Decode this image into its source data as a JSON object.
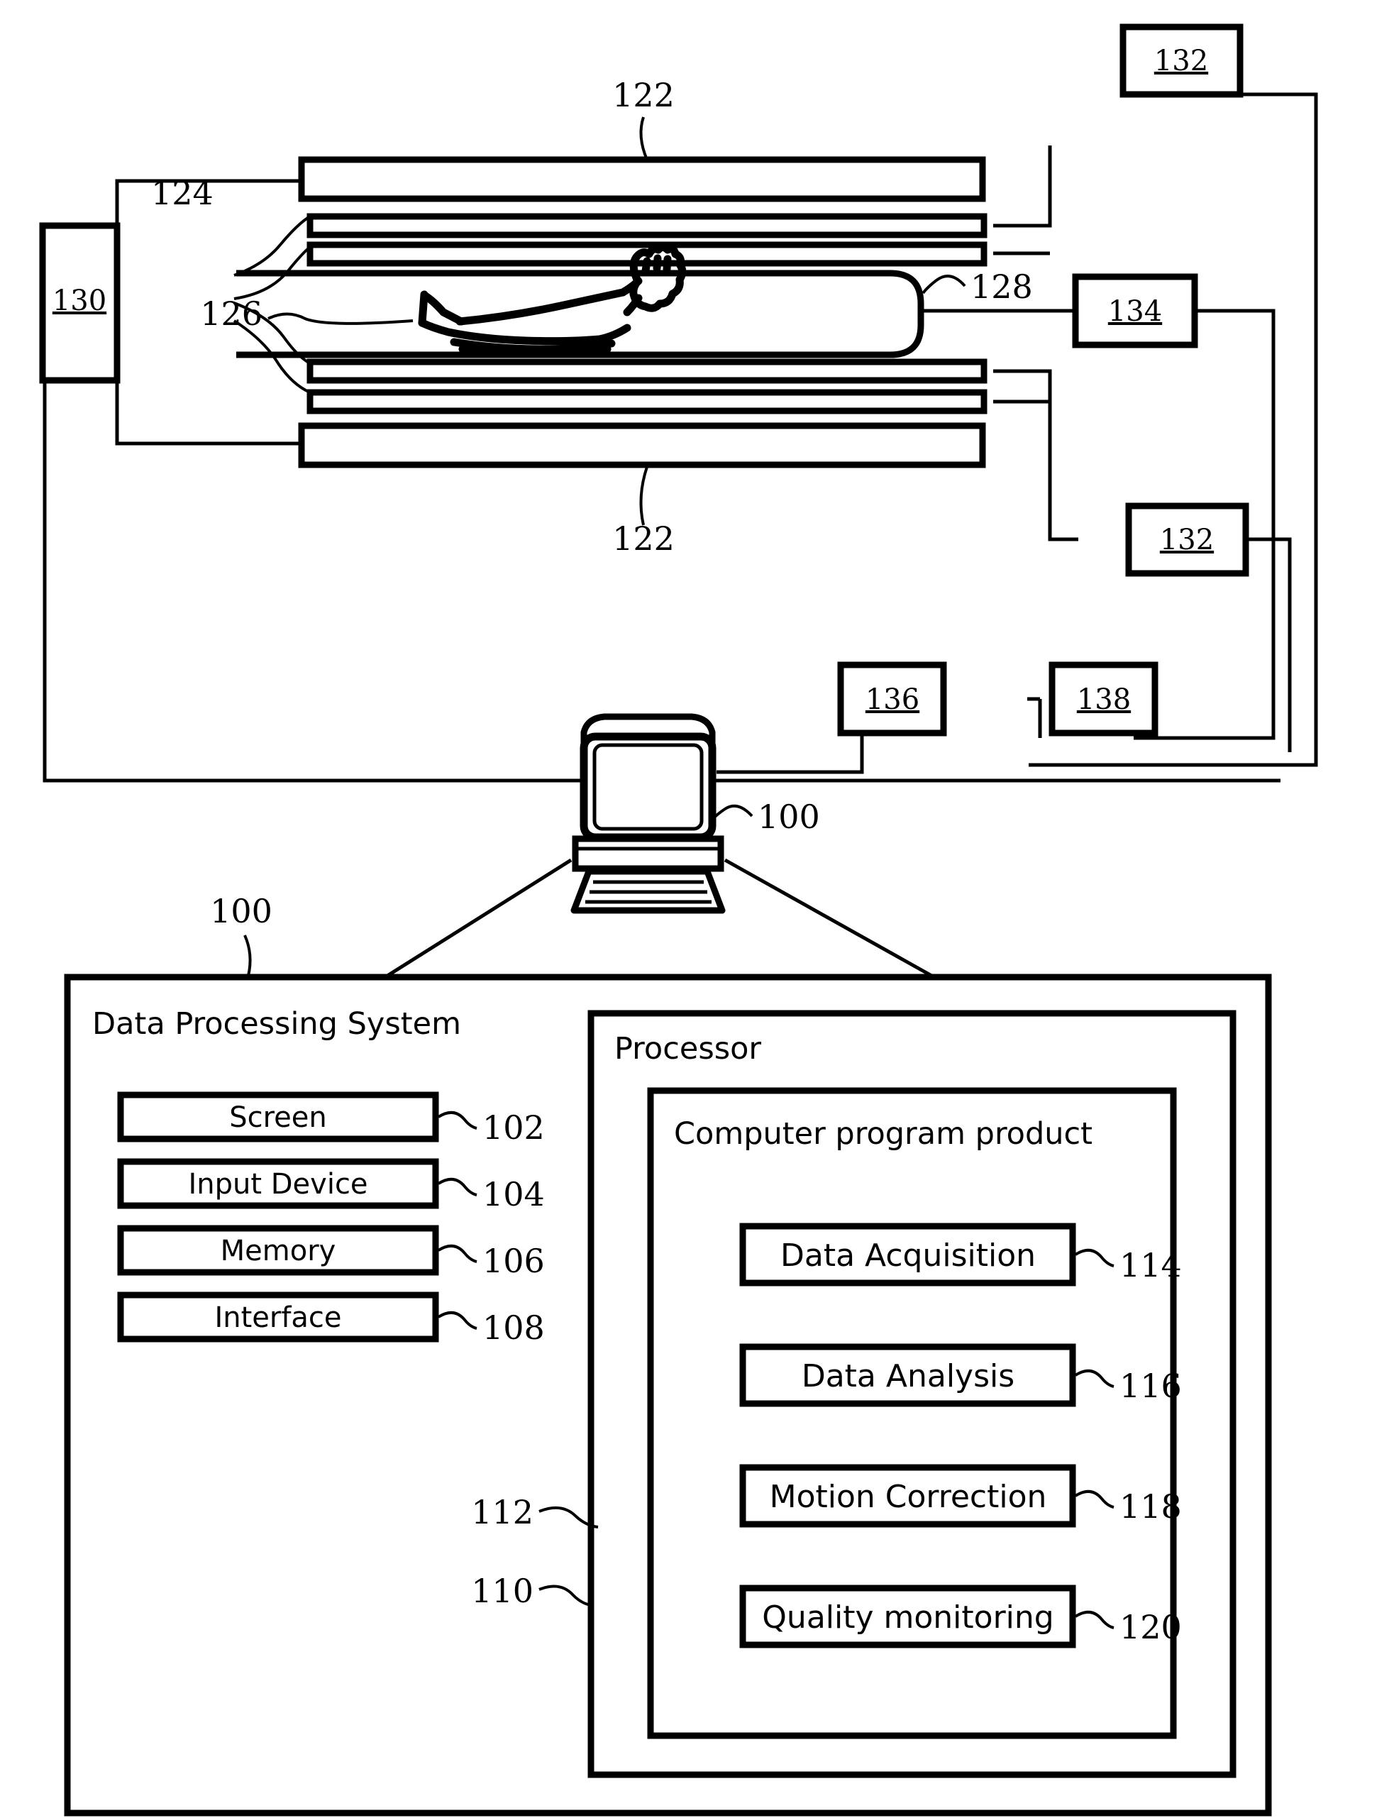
{
  "figure": {
    "type": "patent-diagram",
    "title": "",
    "description": "MRI system block diagram with data processing system"
  },
  "scanner": {
    "magnet_top_label": "122",
    "magnet_bottom_label": "122",
    "gradient_coils_label": "124",
    "subject_label": "126",
    "bore_label": "128",
    "power_supply_label": "130",
    "amplifier_top_label": "132",
    "amplifier_bottom_label": "132",
    "transceiver_label": "134",
    "unit_136_label": "136",
    "unit_138_label": "138",
    "workstation_label": "100"
  },
  "dps": {
    "callout": "100",
    "title": "Data Processing System",
    "components": [
      {
        "label": "Screen",
        "ref": "102"
      },
      {
        "label": "Input Device",
        "ref": "104"
      },
      {
        "label": "Memory",
        "ref": "106"
      },
      {
        "label": "Interface",
        "ref": "108"
      }
    ],
    "processor": {
      "title": "Processor",
      "ref": "110",
      "program": {
        "title": "Computer program product",
        "ref": "112",
        "modules": [
          {
            "label": "Data Acquisition",
            "ref": "114"
          },
          {
            "label": "Data Analysis",
            "ref": "116"
          },
          {
            "label": "Motion Correction",
            "ref": "118"
          },
          {
            "label": "Quality monitoring",
            "ref": "120"
          }
        ]
      }
    }
  },
  "colors": {
    "stroke": "#000000",
    "background": "#ffffff"
  }
}
